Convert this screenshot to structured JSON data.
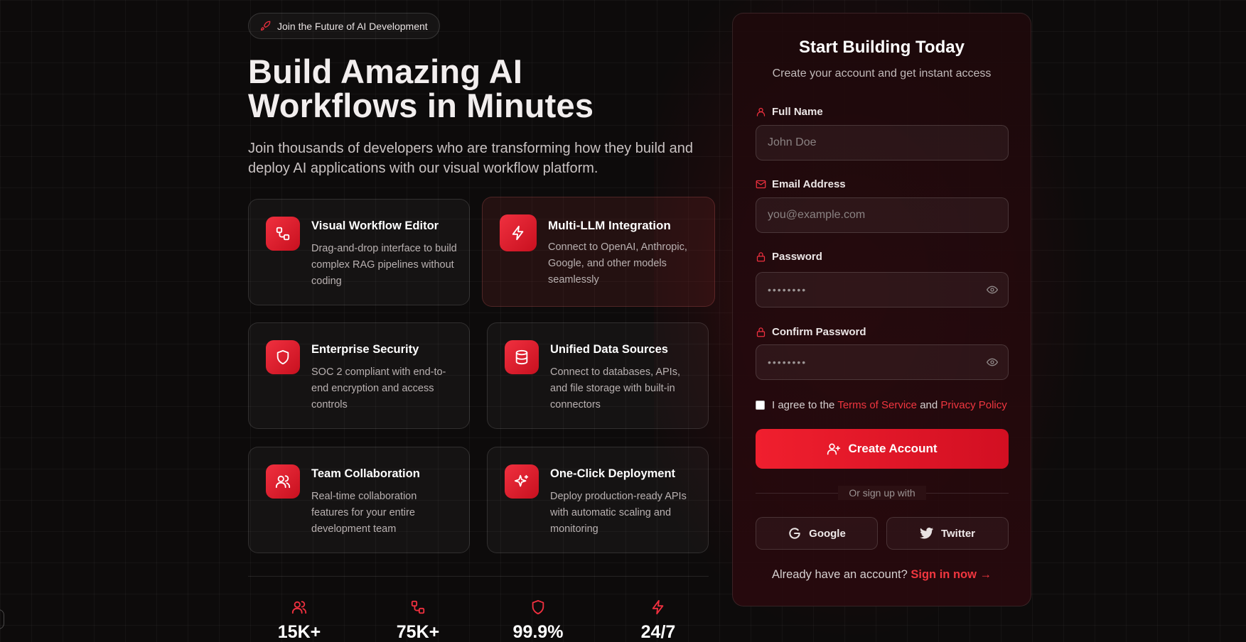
{
  "hero": {
    "badge": "Join the Future of AI Development",
    "title": "Build Amazing AI Workflows in Minutes",
    "subtitle": "Join thousands of developers who are transforming how they build and deploy AI applications with our visual workflow platform."
  },
  "features": [
    {
      "title": "Visual Workflow Editor",
      "desc": "Drag-and-drop interface to build complex RAG pipelines without coding",
      "icon": "workflow-icon"
    },
    {
      "title": "Multi-LLM Integration",
      "desc": "Connect to OpenAI, Anthropic, Google, and other models seamlessly",
      "icon": "lightning-icon"
    },
    {
      "title": "Enterprise Security",
      "desc": "SOC 2 compliant with end-to-end encryption and access controls",
      "icon": "shield-icon"
    },
    {
      "title": "Unified Data Sources",
      "desc": "Connect to databases, APIs, and file storage with built-in connectors",
      "icon": "database-icon"
    },
    {
      "title": "Team Collaboration",
      "desc": "Real-time collaboration features for your entire development team",
      "icon": "users-icon"
    },
    {
      "title": "One-Click Deployment",
      "desc": "Deploy production-ready APIs with automatic scaling and monitoring",
      "icon": "sparkles-icon"
    }
  ],
  "stats": [
    {
      "value": "15K+",
      "icon": "users-icon"
    },
    {
      "value": "75K+",
      "icon": "workflow-icon"
    },
    {
      "value": "99.9%",
      "icon": "shield-icon"
    },
    {
      "value": "24/7",
      "icon": "lightning-icon"
    }
  ],
  "form": {
    "title": "Start Building Today",
    "subtitle": "Create your account and get instant access",
    "full_name_label": "Full Name",
    "full_name_placeholder": "John Doe",
    "email_label": "Email Address",
    "email_placeholder": "you@example.com",
    "password_label": "Password",
    "password_value": "••••••••",
    "confirm_label": "Confirm Password",
    "confirm_value": "••••••••",
    "agree_prefix": "I agree to the",
    "terms_link": "Terms of Service",
    "and_text": "and",
    "privacy_link": "Privacy Policy",
    "create_button": "Create Account",
    "or_text": "Or sign up with",
    "google_button": "Google",
    "twitter_button": "Twitter",
    "have_account": "Already have an account?",
    "signin_link": "Sign in now"
  },
  "colors": {
    "accent": "#f0303f",
    "background": "#0d0b0b"
  }
}
